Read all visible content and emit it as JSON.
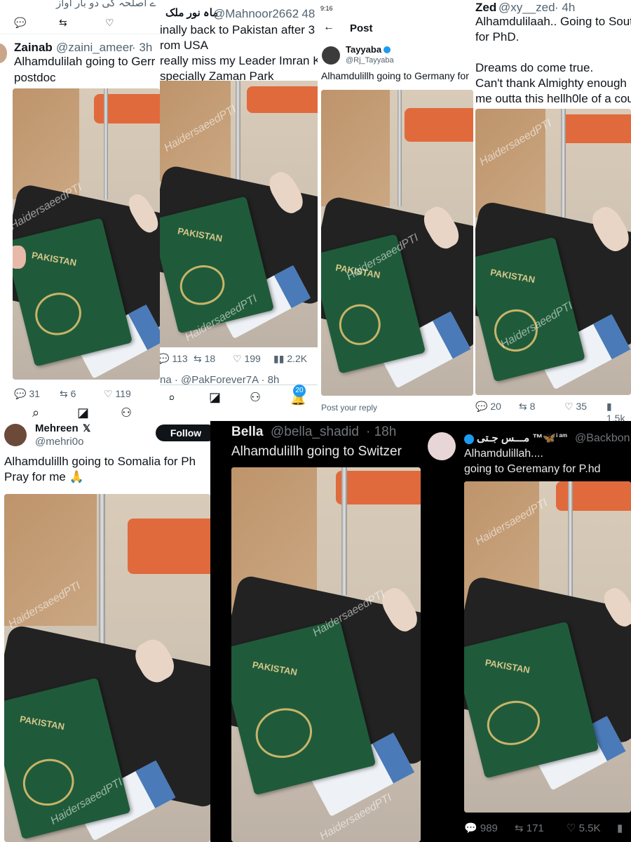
{
  "watermark": "HaidersaeedPTI",
  "p1": {
    "top_text": "ے اصلحہ کی دو بار آواز",
    "name": "Zainab",
    "handle": "@zaini_ameer",
    "time": "· 3h",
    "text1": "Alhamdulilah going to Gerr",
    "text2": "postdoc",
    "stats": {
      "replies": "31",
      "reposts": "6",
      "likes": "119"
    }
  },
  "p2": {
    "name": "ماہ نور ملک",
    "handle": "@Mahnoor2662",
    "time": "· 48",
    "line1": "inally back to Pakistan after 3 ye",
    "line2": "rom USA",
    "line3": "really miss my Leader Imran Kha",
    "line4": "specially Zaman Park",
    "stats": {
      "replies": "113",
      "reposts": "18",
      "likes": "199",
      "views": "2.2K"
    },
    "next_row": "na · @PakForever7A · 8h",
    "badge": "20"
  },
  "p3": {
    "status_time": "9:16",
    "header": "Post",
    "name": "Tayyaba",
    "handle": "@Rj_Tayyaba",
    "text": "Alhamdulillh going to Germany for",
    "reply_placeholder": "Post your reply"
  },
  "p4": {
    "name": "Zed",
    "handle": "@xy__zed",
    "time": "· 4h",
    "line1": "Alhamdulilaah.. Going to Sout",
    "line2": "for PhD.",
    "line3": "Dreams do come true.",
    "line4": "Can't thank Almighty enough",
    "line5": "me outta this hellh0le of a cou",
    "stats": {
      "replies": "20",
      "reposts": "8",
      "likes": "35",
      "views": "1.5k"
    }
  },
  "p5": {
    "name": "Mehreen",
    "handle": "@mehri0o",
    "follow": "Follow",
    "text1": "Alhamdulillh going to Somalia for Ph",
    "text2": "Pray for me 🙏"
  },
  "p6": {
    "name": "Bella",
    "handle": "@bella_shadid",
    "time": "· 18h",
    "text": "Alhamdulillh going to Switzer"
  },
  "p7": {
    "name": "مـــس جـتی ™🦋",
    "name_sup": "i am",
    "handle": "@Backbon",
    "text1": "Alhamdulillah....",
    "text2": "going to Geremany for P.hd",
    "stats": {
      "replies": "989",
      "reposts": "171",
      "likes": "5.5K"
    }
  },
  "passport_title": "PAKISTAN",
  "colors": {
    "twitter_blue": "#1d9bf0",
    "passport_green": "#1f5b3a",
    "dark_bg": "#000000"
  }
}
